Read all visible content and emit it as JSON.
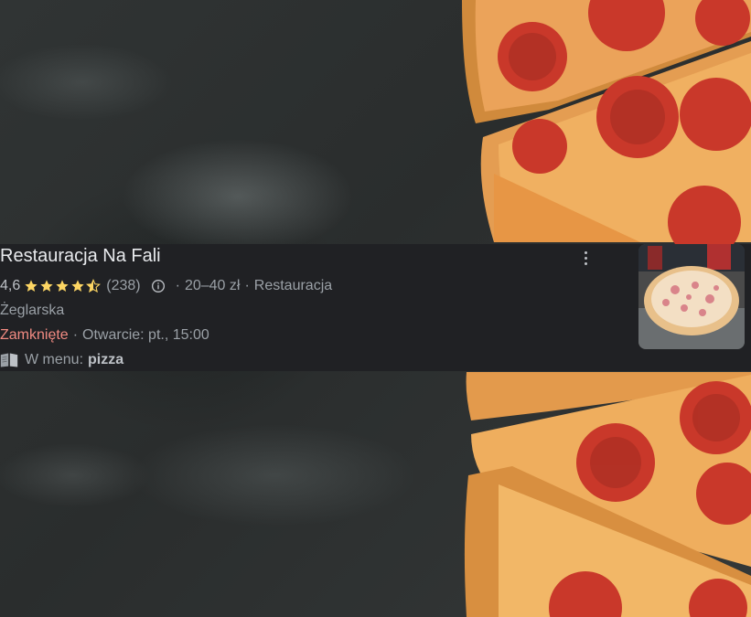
{
  "place": {
    "name": "Restauracja Na Fali",
    "rating": "4,6",
    "rating_value": 4.6,
    "review_count": "(238)",
    "price_range": "20–40 zł",
    "category": "Restauracja",
    "category_line2": "Żeglarska",
    "status": "Zamknięte",
    "opening": "Otwarcie: pt., 15:00",
    "menu_label": "W menu:",
    "menu_item": "pizza"
  },
  "separator": "·",
  "colors": {
    "card_bg": "#202124",
    "star": "#fdd663",
    "closed": "#f28b82",
    "muted": "#9aa0a6",
    "text": "#e8eaed"
  },
  "icons": {
    "more": "more-vert-icon",
    "info": "info-icon",
    "menu": "menu-book-icon",
    "star": "star-icon"
  }
}
